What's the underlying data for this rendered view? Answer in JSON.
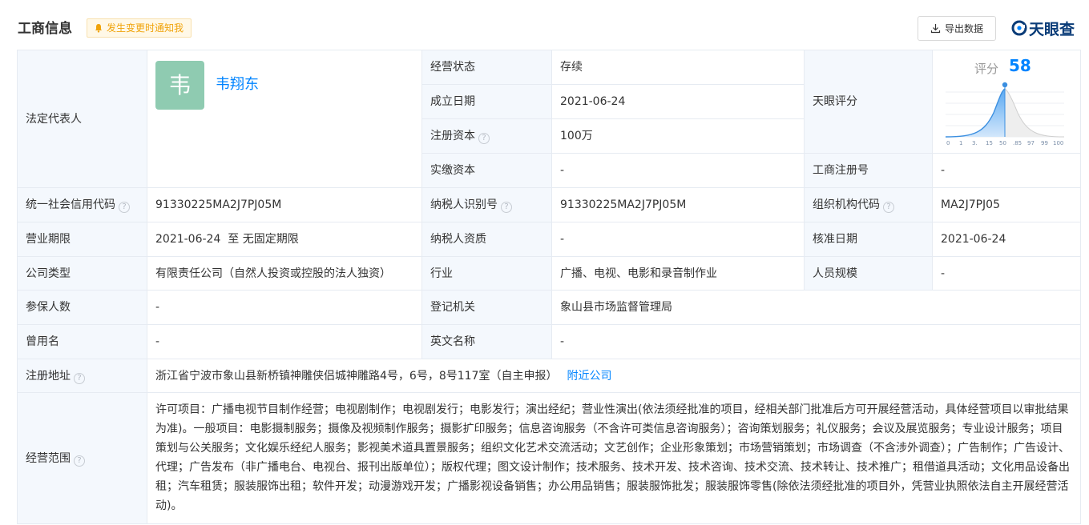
{
  "header": {
    "title": "工商信息",
    "notify_label": "发生变更时通知我",
    "export_label": "导出数据",
    "logo_text": "天眼查"
  },
  "legal_rep": {
    "label": "法定代表人",
    "avatar_char": "韦",
    "name": "韦翔东"
  },
  "status": {
    "label": "经营状态",
    "value": "存续"
  },
  "founded": {
    "label": "成立日期",
    "value": "2021-06-24"
  },
  "reg_capital": {
    "label": "注册资本",
    "value": "100万"
  },
  "paid_capital": {
    "label": "实缴资本",
    "value": "-"
  },
  "tianyan_score": {
    "label": "天眼评分",
    "score_label": "评分",
    "score": "58",
    "axis_ticks": [
      "0",
      "1",
      "3.",
      "15",
      "50",
      ".85",
      "97",
      "99",
      "100"
    ]
  },
  "reg_number": {
    "label": "工商注册号",
    "value": "-"
  },
  "credit_code": {
    "label": "统一社会信用代码",
    "value": "91330225MA2J7PJ05M"
  },
  "taxpayer_id": {
    "label": "纳税人识别号",
    "value": "91330225MA2J7PJ05M"
  },
  "org_code": {
    "label": "组织机构代码",
    "value": "MA2J7PJ05"
  },
  "business_term": {
    "label": "营业期限",
    "value": "2021-06-24  至 无固定期限"
  },
  "taxpayer_qual": {
    "label": "纳税人资质",
    "value": "-"
  },
  "approval_date": {
    "label": "核准日期",
    "value": "2021-06-24"
  },
  "company_type": {
    "label": "公司类型",
    "value": "有限责任公司（自然人投资或控股的法人独资）"
  },
  "industry": {
    "label": "行业",
    "value": "广播、电视、电影和录音制作业"
  },
  "staff_size": {
    "label": "人员规模",
    "value": "-"
  },
  "insured": {
    "label": "参保人数",
    "value": "-"
  },
  "reg_authority": {
    "label": "登记机关",
    "value": "象山县市场监督管理局"
  },
  "former_name": {
    "label": "曾用名",
    "value": "-"
  },
  "english_name": {
    "label": "英文名称",
    "value": "-"
  },
  "address": {
    "label": "注册地址",
    "value": "浙江省宁波市象山县新桥镇神雕侠侣城神雕路4号，6号，8号117室（自主申报）",
    "nearby_link": "附近公司"
  },
  "scope": {
    "label": "经营范围",
    "value": "许可项目：广播电视节目制作经营；电视剧制作；电视剧发行；电影发行；演出经纪；营业性演出(依法须经批准的项目，经相关部门批准后方可开展经营活动，具体经营项目以审批结果为准)。一般项目：电影摄制服务；摄像及视频制作服务；摄影扩印服务；信息咨询服务（不含许可类信息咨询服务）；咨询策划服务；礼仪服务；会议及展览服务；专业设计服务；项目策划与公关服务；文化娱乐经纪人服务；影视美术道具置景服务；组织文化艺术交流活动；文艺创作；企业形象策划；市场营销策划；市场调查（不含涉外调查）；广告制作；广告设计、代理；广告发布（非广播电台、电视台、报刊出版单位）；版权代理；图文设计制作；技术服务、技术开发、技术咨询、技术交流、技术转让、技术推广；租借道具活动；文化用品设备出租；汽车租赁；服装服饰出租；软件开发；动漫游戏开发；广播影视设备销售；办公用品销售；服装服饰批发；服装服饰零售(除依法须经批准的项目外，凭营业执照依法自主开展经营活动)。"
  },
  "colors": {
    "accent": "#0084ff",
    "label_bg": "#f4f8fd",
    "border": "#e6ebf2",
    "avatar_bg": "#8fcbb1",
    "notify": "#f0a30a"
  }
}
